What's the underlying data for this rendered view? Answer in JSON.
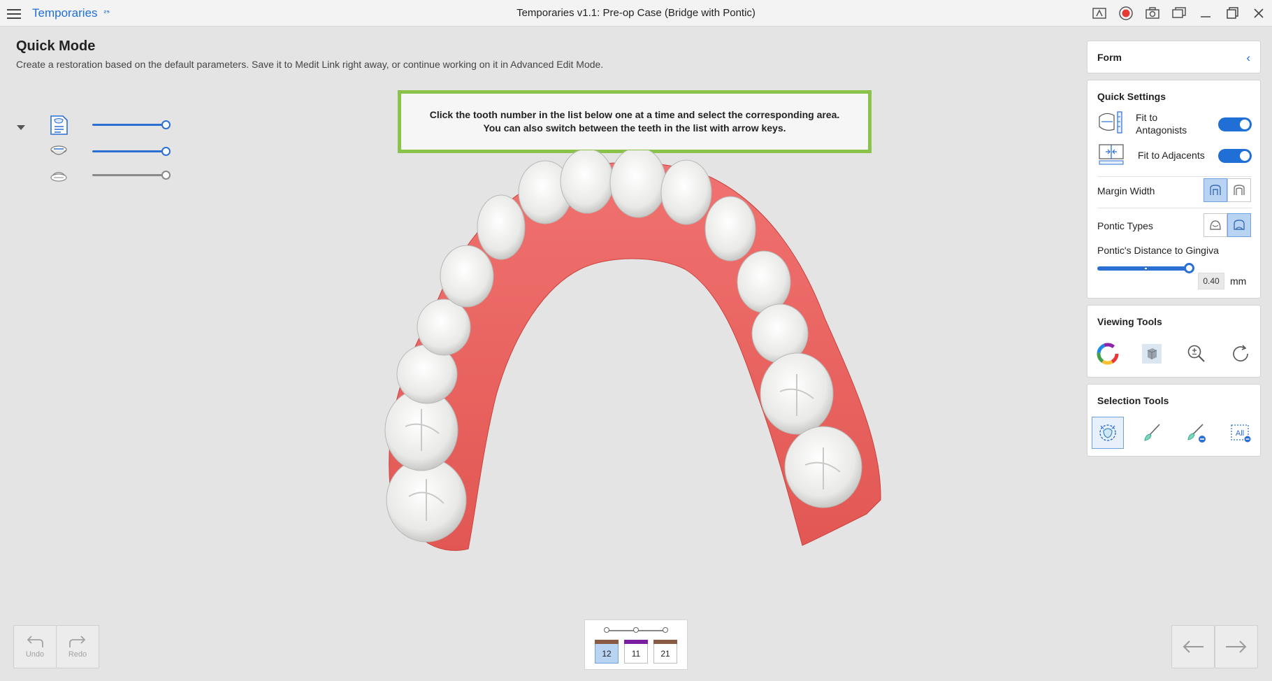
{
  "app": {
    "name": "Temporaries",
    "badge": "₂₅",
    "window_title": "Temporaries v1.1: Pre-op Case (Bridge with Pontic)"
  },
  "titlebar_icons": [
    "screen-capture-icon",
    "record-icon",
    "camera-icon",
    "window-icon",
    "minimize-icon",
    "maximize-icon",
    "close-icon"
  ],
  "header": {
    "title": "Quick Mode",
    "description": "Create a restoration based on the default parameters. Save it to Medit Link right away, or continue working on it in Advanced Edit Mode."
  },
  "instruction": {
    "line1": "Click the tooth number in the list below one at a time and select the corresponding area.",
    "line2": "You can also switch between the teeth in the list with arrow keys."
  },
  "layers": [
    {
      "icon": "restoration-layer-icon",
      "color": "#2b6fd3",
      "opacity": 1.0
    },
    {
      "icon": "maxilla-scan-icon",
      "color": "#2b6fd3",
      "opacity": 1.0
    },
    {
      "icon": "mandible-scan-icon",
      "color": "#8a8a8a",
      "opacity": 1.0
    }
  ],
  "form": {
    "title": "Form"
  },
  "quick_settings": {
    "title": "Quick Settings",
    "fit_to_antagonists": {
      "label_line1": "Fit to",
      "label_line2": "Antagonists",
      "enabled": true
    },
    "fit_to_adjacents": {
      "label": "Fit to Adjacents",
      "enabled": true
    },
    "margin_width": {
      "label": "Margin Width",
      "selected": 0
    },
    "pontic_types": {
      "label": "Pontic Types",
      "selected": 1
    },
    "pontic_distance": {
      "label": "Pontic's Distance to Gingiva",
      "value": "0.40",
      "unit": "mm",
      "level": 0.95
    }
  },
  "viewing_tools": {
    "title": "Viewing Tools",
    "items": [
      "color-wheel-icon",
      "cube-view-icon",
      "zoom-icon",
      "rotate-reset-icon"
    ]
  },
  "selection_tools": {
    "title": "Selection Tools",
    "items": [
      "smart-select-icon",
      "brush-icon",
      "erase-brush-icon",
      "select-all-icon"
    ],
    "select_all_text": "All"
  },
  "bottom": {
    "undo": "Undo",
    "redo": "Redo"
  },
  "teeth": [
    {
      "number": "12",
      "color": "#8a5a44",
      "active": true
    },
    {
      "number": "11",
      "color": "#7b1fa2",
      "active": false
    },
    {
      "number": "21",
      "color": "#8a5a44",
      "active": false
    }
  ],
  "colors": {
    "accent": "#1f6fd6",
    "instruction_border": "#8bc34a",
    "gum": "#e8625f",
    "tooth": "#f2f2f0"
  }
}
